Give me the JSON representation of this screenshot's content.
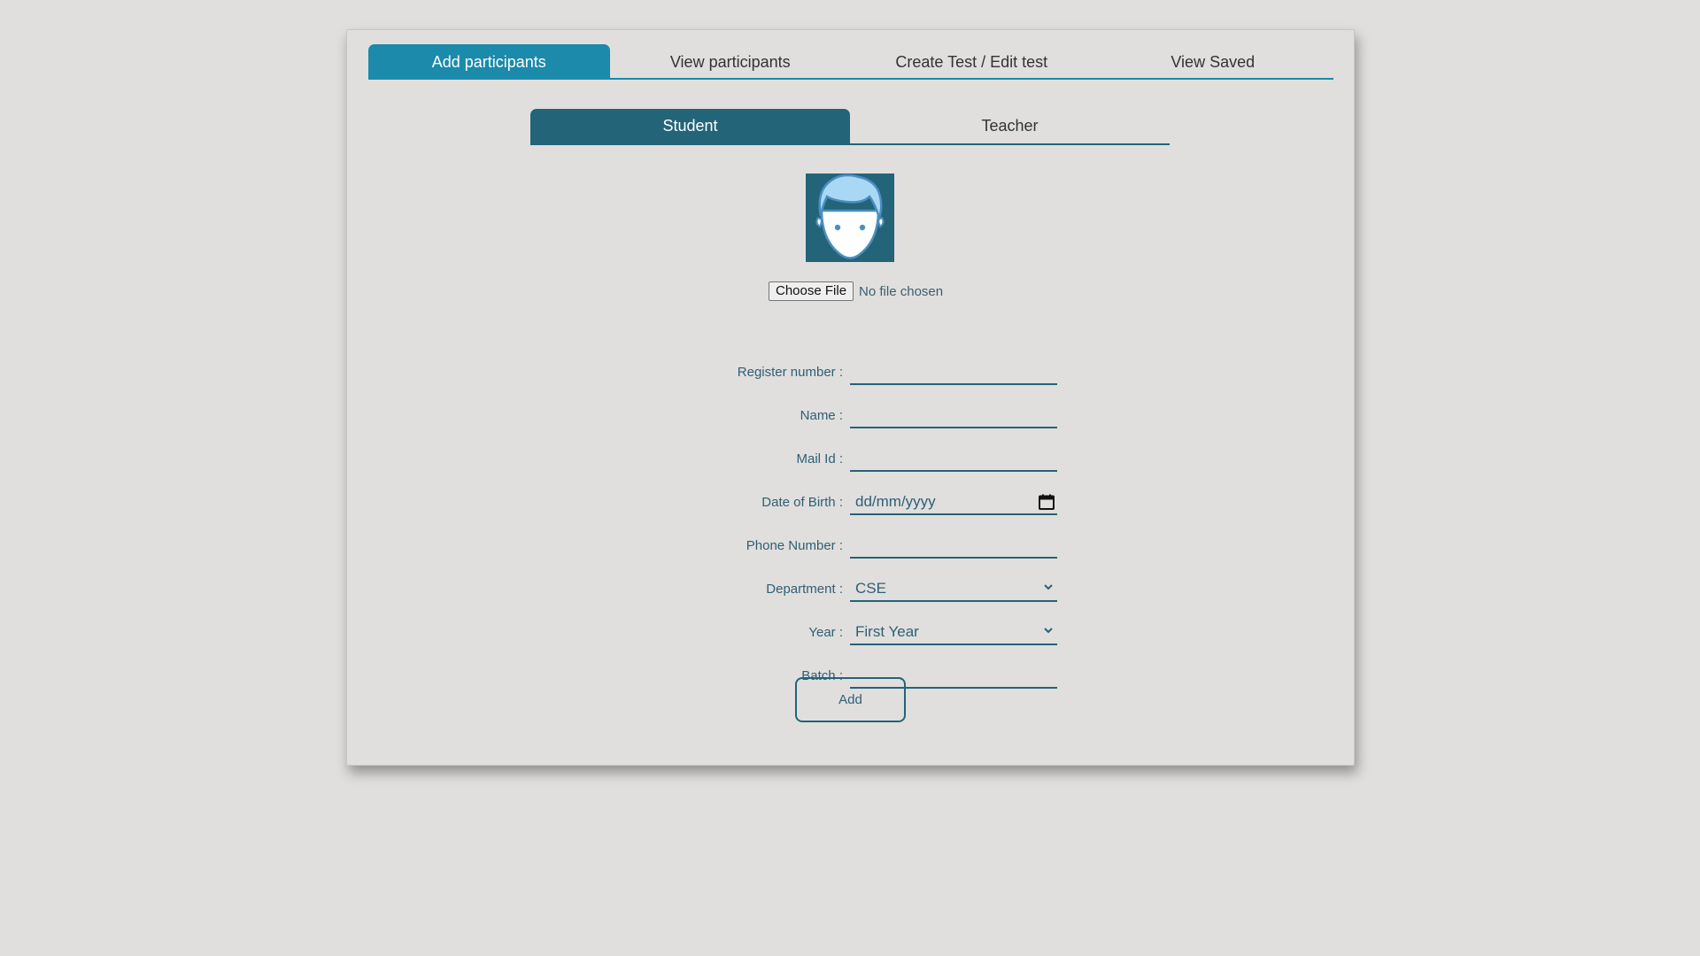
{
  "main_tabs": [
    {
      "label": "Add participants"
    },
    {
      "label": "View participants"
    },
    {
      "label": "Create Test / Edit test"
    },
    {
      "label": "View Saved"
    }
  ],
  "participant_tabs": [
    {
      "label": "Student"
    },
    {
      "label": "Teacher"
    }
  ],
  "avatar": {
    "icon": "person-face-icon"
  },
  "file_upload": {
    "button_label": "Choose File",
    "status": "No file chosen"
  },
  "form": {
    "register_number": {
      "label": "Register number :",
      "value": ""
    },
    "name": {
      "label": "Name :",
      "value": ""
    },
    "mail_id": {
      "label": "Mail Id :",
      "value": ""
    },
    "date_of_birth": {
      "label": "Date of Birth :",
      "placeholder": "dd/mm/yyyy"
    },
    "phone_number": {
      "label": "Phone Number :",
      "value": ""
    },
    "department": {
      "label": "Department :",
      "value": "CSE"
    },
    "year": {
      "label": "Year :",
      "value": "First Year"
    },
    "batch": {
      "label": "Batch :",
      "value": ""
    }
  },
  "add_button_label": "Add",
  "colors": {
    "active_main_tab": "#1b8aab",
    "active_sub_tab": "#236479",
    "background": "#e0dfdd"
  }
}
